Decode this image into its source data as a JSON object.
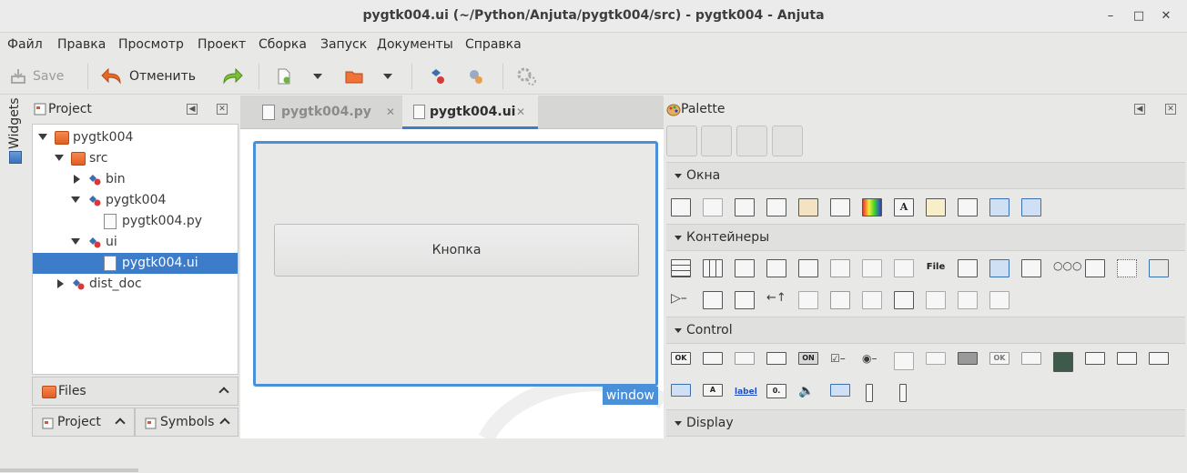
{
  "window": {
    "title": "pygtk004.ui (~/Python/Anjuta/pygtk004/src) - pygtk004 - Anjuta"
  },
  "menu": [
    "Файл",
    "Правка",
    "Просмотр",
    "Проект",
    "Сборка",
    "Запуск",
    "Документы",
    "Справка"
  ],
  "toolbar": {
    "save_label": "Save",
    "undo_label": "Отменить"
  },
  "sidebar": {
    "widgets_label": "Widgets"
  },
  "project": {
    "title": "Project",
    "tree": [
      {
        "label": "pygtk004",
        "icon": "folder-icon",
        "expanded": true
      },
      {
        "label": "src",
        "icon": "folder-icon",
        "expanded": true
      },
      {
        "label": "bin",
        "icon": "package-icon",
        "expanded": false
      },
      {
        "label": "pygtk004",
        "icon": "package-icon",
        "expanded": true
      },
      {
        "label": "pygtk004.py",
        "icon": "file-icon"
      },
      {
        "label": "ui",
        "icon": "package-icon",
        "expanded": true
      },
      {
        "label": "pygtk004.ui",
        "icon": "file-icon",
        "selected": true
      },
      {
        "label": "dist_doc",
        "icon": "package-icon",
        "expanded": false
      }
    ],
    "files_label": "Files",
    "project_tab": "Project",
    "symbols_tab": "Symbols"
  },
  "editor": {
    "tabs": [
      {
        "label": "pygtk004.py",
        "active": false
      },
      {
        "label": "pygtk004.ui",
        "active": true
      }
    ],
    "button_label": "Кнопка",
    "window_tag": "window"
  },
  "palette": {
    "title": "Palette",
    "sections": {
      "windows": "Окна",
      "containers": "Контейнеры",
      "control": "Control",
      "display": "Display"
    },
    "icon_labels": {
      "ok": "OK",
      "on": "ON",
      "label": "label",
      "file": "File",
      "letter_a": "A",
      "num": "0."
    }
  },
  "colors": {
    "accent": "#3d7cc9",
    "selection": "#3d7cc9",
    "design_border": "#4a90d9"
  }
}
